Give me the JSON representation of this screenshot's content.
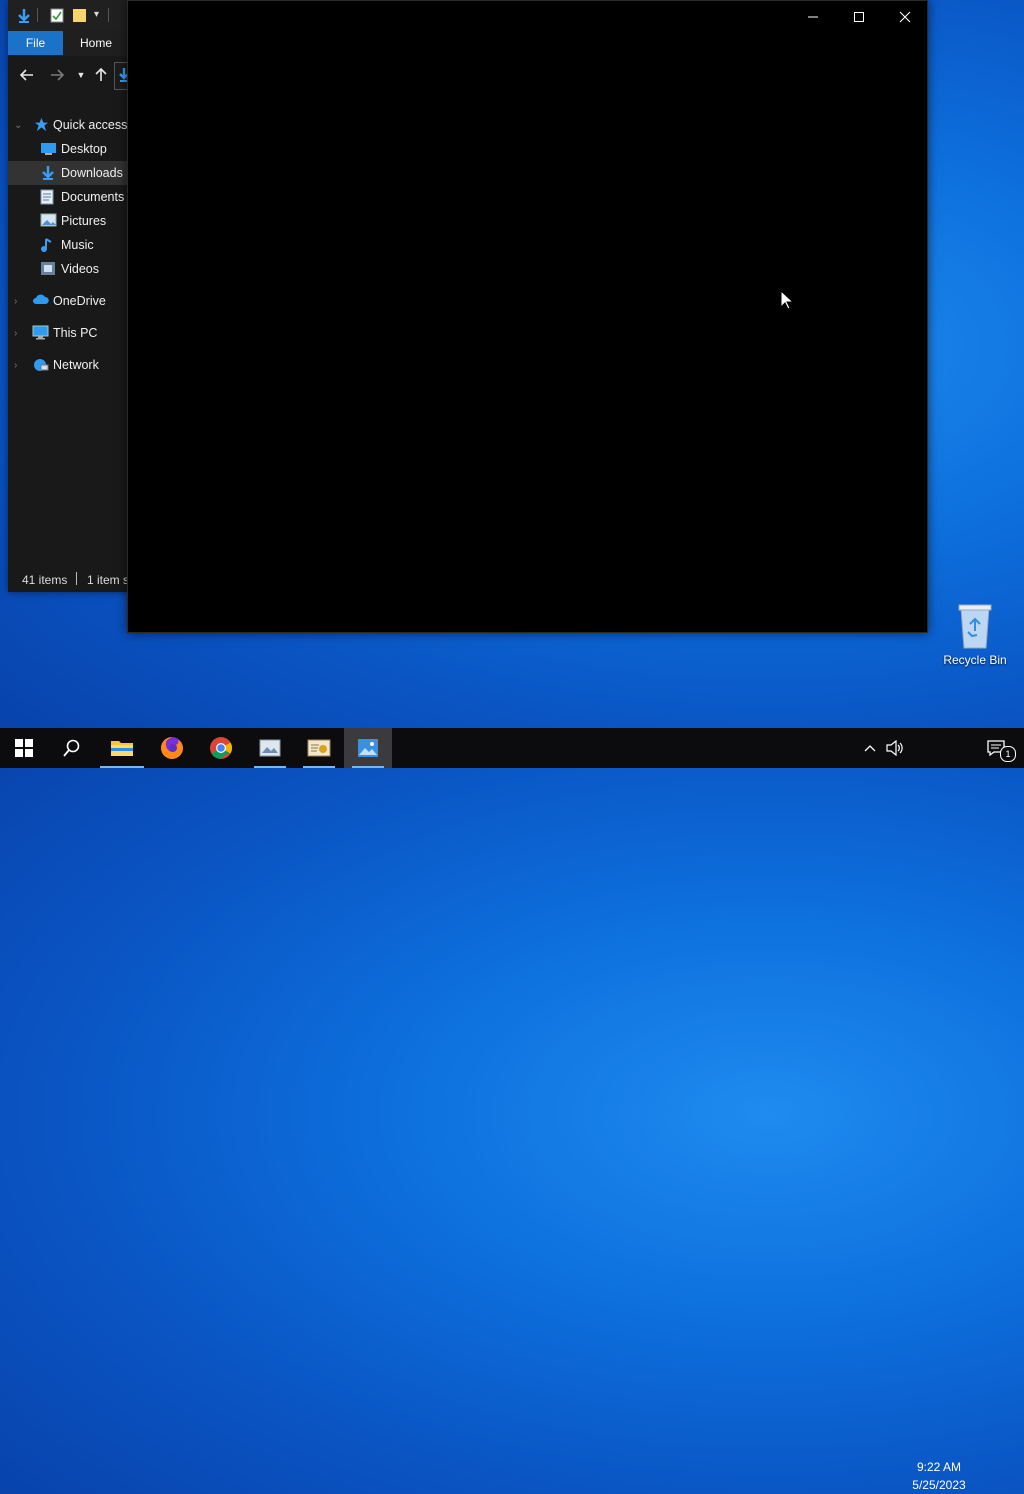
{
  "explorer": {
    "tabs": {
      "file": "File",
      "home": "Home"
    },
    "nav": {
      "quick_access": "Quick access",
      "items": [
        {
          "label": "Desktop",
          "icon": "desktop-icon"
        },
        {
          "label": "Downloads",
          "icon": "downloads-icon"
        },
        {
          "label": "Documents",
          "icon": "documents-icon"
        },
        {
          "label": "Pictures",
          "icon": "pictures-icon"
        },
        {
          "label": "Music",
          "icon": "music-icon"
        },
        {
          "label": "Videos",
          "icon": "videos-icon"
        }
      ],
      "onedrive": "OneDrive",
      "this_pc": "This PC",
      "network": "Network"
    },
    "status": {
      "items": "41 items",
      "selected": "1 item s"
    }
  },
  "desktop": {
    "recycle_bin": "Recycle Bin"
  },
  "taskbar": {
    "time": "9:22 AM",
    "date": "5/25/2023",
    "notification_count": "1"
  },
  "colors": {
    "accent": "#1a73c8",
    "selection": "#333333",
    "taskbar": "#0c0c0e"
  }
}
